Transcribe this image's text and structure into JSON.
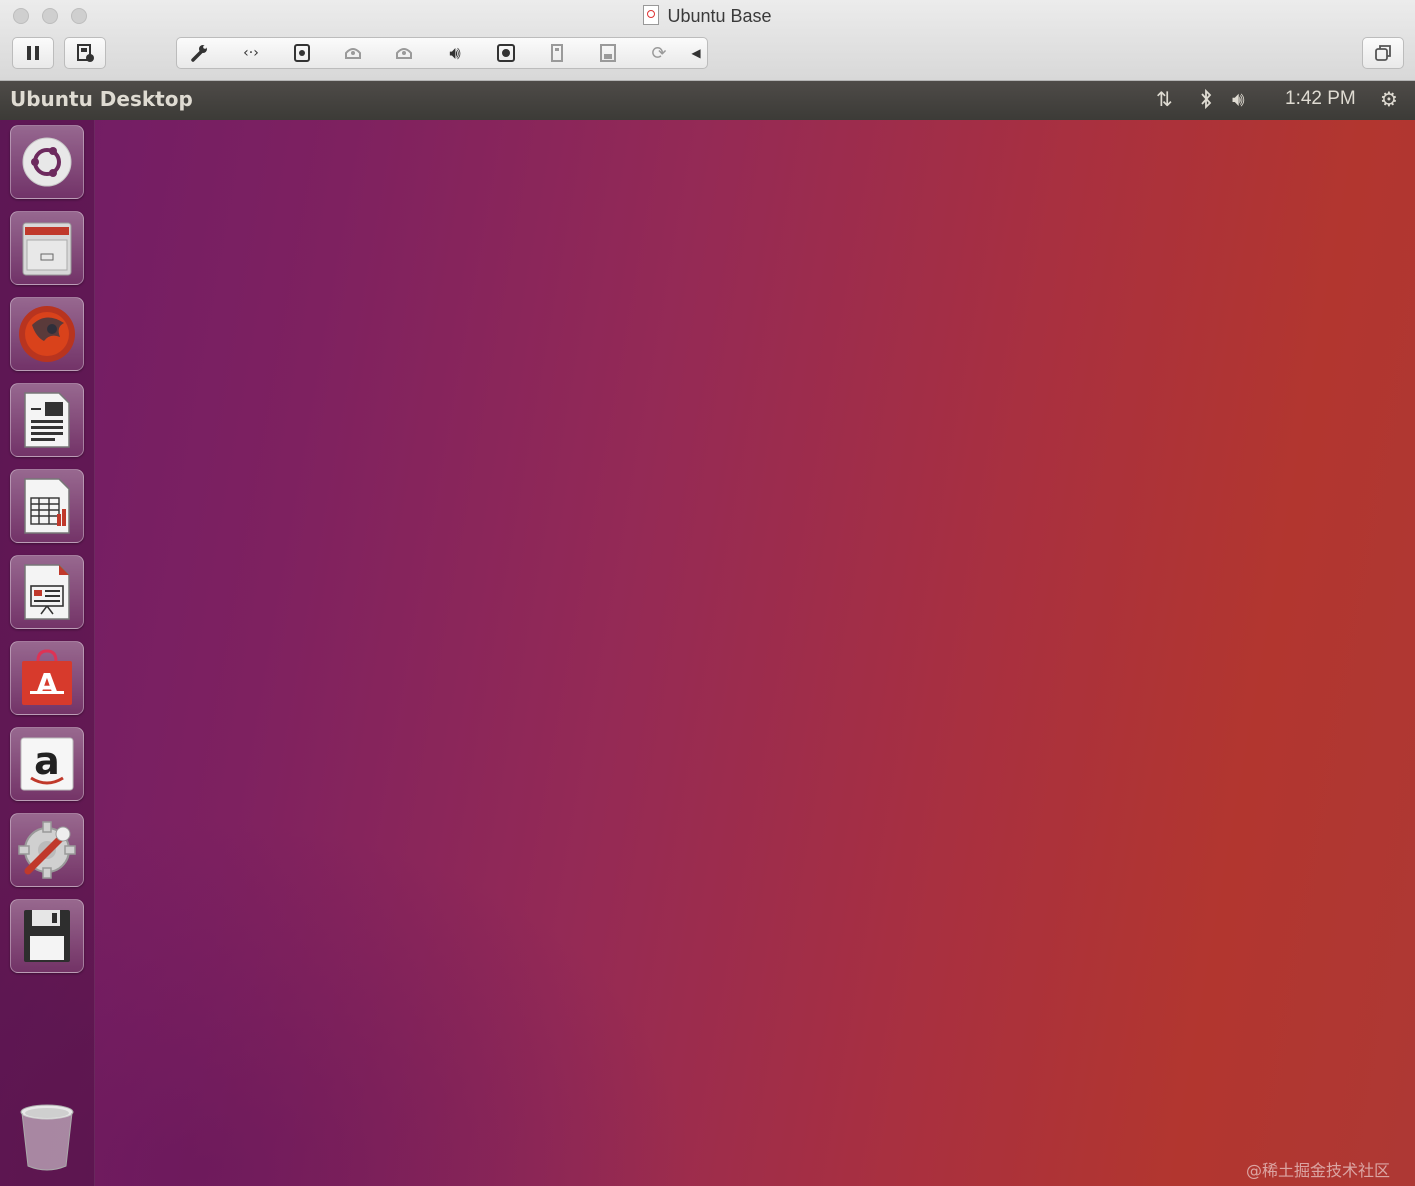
{
  "window": {
    "title": "Ubuntu Base"
  },
  "panel": {
    "title": "Ubuntu Desktop",
    "clock": "1:42 PM"
  },
  "launcher": {
    "items": [
      "dash-home",
      "files",
      "firefox",
      "libreoffice-writer",
      "libreoffice-calc",
      "libreoffice-impress",
      "software-center",
      "amazon",
      "system-settings",
      "floppy",
      "trash"
    ]
  },
  "watermark": "@稀土掘金技术社区",
  "colors": {
    "panel": "#3c3b37",
    "desktop_left": "#6f1c66",
    "desktop_right": "#b2362f"
  }
}
